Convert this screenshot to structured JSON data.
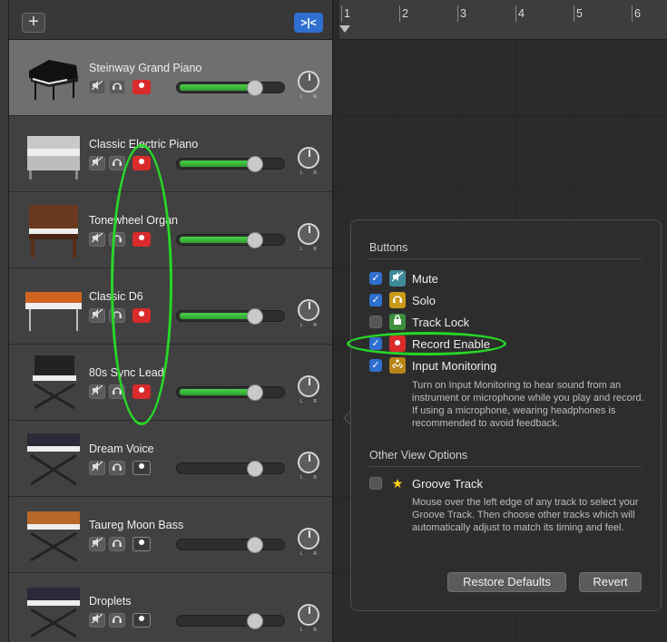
{
  "toolbar": {
    "add_label": "+",
    "filter_label": ">|<"
  },
  "ruler": {
    "bars": [
      "1",
      "2",
      "3",
      "4",
      "5",
      "6"
    ]
  },
  "tracks": [
    {
      "name": "Steinway Grand Piano",
      "record_enabled": true,
      "selected": true,
      "volume_meter": 0.7
    },
    {
      "name": "Classic Electric Piano",
      "record_enabled": true,
      "selected": false,
      "volume_meter": 0.7
    },
    {
      "name": "Tonewheel Organ",
      "record_enabled": true,
      "selected": false,
      "volume_meter": 0.7
    },
    {
      "name": "Classic D6",
      "record_enabled": true,
      "selected": false,
      "volume_meter": 0.8
    },
    {
      "name": "80s Sync Lead",
      "record_enabled": true,
      "selected": false,
      "volume_meter": 0.8
    },
    {
      "name": "Dream Voice",
      "record_enabled": false,
      "selected": false,
      "volume_meter": 0
    },
    {
      "name": "Taureg Moon Bass",
      "record_enabled": false,
      "selected": false,
      "volume_meter": 0
    },
    {
      "name": "Droplets",
      "record_enabled": false,
      "selected": false,
      "volume_meter": 0
    }
  ],
  "pan": {
    "left": "L",
    "right": "R"
  },
  "popover": {
    "buttons_title": "Buttons",
    "options": [
      {
        "label": "Mute",
        "checked": true,
        "icon": "mute-icon",
        "color": "#3f8a9a"
      },
      {
        "label": "Solo",
        "checked": true,
        "icon": "headphones-icon",
        "color": "#c99a1a"
      },
      {
        "label": "Track Lock",
        "checked": false,
        "icon": "lock-icon",
        "color": "#3e8f3e"
      },
      {
        "label": "Record Enable",
        "checked": true,
        "icon": "record-icon",
        "color": "#d92b2b"
      },
      {
        "label": "Input Monitoring",
        "checked": true,
        "icon": "input-monitoring-icon",
        "color": "#b8841a"
      }
    ],
    "input_monitoring_desc": "Turn on Input Monitoring to hear sound from an instrument or microphone while you play and record. If using a microphone, wearing headphones is recommended to avoid feedback.",
    "other_title": "Other View Options",
    "groove_label": "Groove Track",
    "groove_checked": false,
    "groove_desc": "Mouse over the left edge of any track to select your Groove Track. Then choose other tracks which will automatically adjust to match its timing and feel.",
    "restore_label": "Restore Defaults",
    "revert_label": "Revert"
  },
  "colors": {
    "accent": "#2f6fcf",
    "annotation": "#27d827",
    "record": "#d92b2b",
    "meter": "#3fbf3f"
  }
}
